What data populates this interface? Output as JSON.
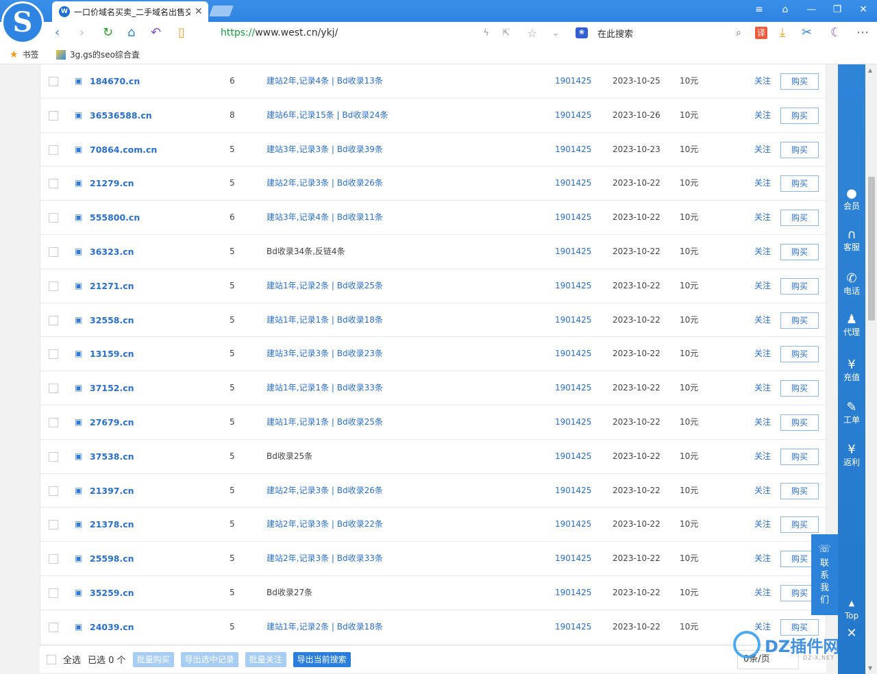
{
  "browser": {
    "tab_title": "一口价域名买卖_二手域名出售交",
    "tab_close": "✕",
    "url_scheme": "https://",
    "url_rest": "www.west.cn/ykj/",
    "search_placeholder": "在此搜索",
    "bookmarks_label": "书签",
    "bookmark_1": "3g.gs的seo综合査"
  },
  "table": {
    "rows": [
      {
        "domain": "184670.cn",
        "len": "6",
        "history": "建站2年,记录4条 | Bd收录13条",
        "seller": "1901425",
        "date": "2023-10-25",
        "price": "10元",
        "follow": "关注",
        "buy": "购买"
      },
      {
        "domain": "36536588.cn",
        "len": "8",
        "history": "建站6年,记录15条 | Bd收录24条",
        "seller": "1901425",
        "date": "2023-10-26",
        "price": "10元",
        "follow": "关注",
        "buy": "购买"
      },
      {
        "domain": "70864.com.cn",
        "len": "5",
        "history": "建站3年,记录3条 | Bd收录39条",
        "seller": "1901425",
        "date": "2023-10-23",
        "price": "10元",
        "follow": "关注",
        "buy": "购买"
      },
      {
        "domain": "21279.cn",
        "len": "5",
        "history": "建站2年,记录3条 | Bd收录26条",
        "seller": "1901425",
        "date": "2023-10-22",
        "price": "10元",
        "follow": "关注",
        "buy": "购买"
      },
      {
        "domain": "555800.cn",
        "len": "6",
        "history": "建站3年,记录4条 | Bd收录11条",
        "seller": "1901425",
        "date": "2023-10-22",
        "price": "10元",
        "follow": "关注",
        "buy": "购买"
      },
      {
        "domain": "36323.cn",
        "len": "5",
        "history": "Bd收录34条,反链4条",
        "seller": "1901425",
        "date": "2023-10-22",
        "price": "10元",
        "follow": "关注",
        "buy": "购买"
      },
      {
        "domain": "21271.cn",
        "len": "5",
        "history": "建站1年,记录2条 | Bd收录25条",
        "seller": "1901425",
        "date": "2023-10-22",
        "price": "10元",
        "follow": "关注",
        "buy": "购买"
      },
      {
        "domain": "32558.cn",
        "len": "5",
        "history": "建站1年,记录1条 | Bd收录18条",
        "seller": "1901425",
        "date": "2023-10-22",
        "price": "10元",
        "follow": "关注",
        "buy": "购买"
      },
      {
        "domain": "13159.cn",
        "len": "5",
        "history": "建站3年,记录3条 | Bd收录23条",
        "seller": "1901425",
        "date": "2023-10-22",
        "price": "10元",
        "follow": "关注",
        "buy": "购买"
      },
      {
        "domain": "37152.cn",
        "len": "5",
        "history": "建站1年,记录1条 | Bd收录33条",
        "seller": "1901425",
        "date": "2023-10-22",
        "price": "10元",
        "follow": "关注",
        "buy": "购买"
      },
      {
        "domain": "27679.cn",
        "len": "5",
        "history": "建站1年,记录1条 | Bd收录25条",
        "seller": "1901425",
        "date": "2023-10-22",
        "price": "10元",
        "follow": "关注",
        "buy": "购买"
      },
      {
        "domain": "37538.cn",
        "len": "5",
        "history": "Bd收录25条",
        "seller": "1901425",
        "date": "2023-10-22",
        "price": "10元",
        "follow": "关注",
        "buy": "购买"
      },
      {
        "domain": "21397.cn",
        "len": "5",
        "history": "建站2年,记录3条 | Bd收录26条",
        "seller": "1901425",
        "date": "2023-10-22",
        "price": "10元",
        "follow": "关注",
        "buy": "购买"
      },
      {
        "domain": "21378.cn",
        "len": "5",
        "history": "建站2年,记录3条 | Bd收录22条",
        "seller": "1901425",
        "date": "2023-10-22",
        "price": "10元",
        "follow": "关注",
        "buy": "购买"
      },
      {
        "domain": "25598.cn",
        "len": "5",
        "history": "建站2年,记录3条 | Bd收录33条",
        "seller": "1901425",
        "date": "2023-10-22",
        "price": "10元",
        "follow": "关注",
        "buy": "购买"
      },
      {
        "domain": "35259.cn",
        "len": "5",
        "history": "Bd收录27条",
        "seller": "1901425",
        "date": "2023-10-22",
        "price": "10元",
        "follow": "关注",
        "buy": "购买"
      },
      {
        "domain": "24039.cn",
        "len": "5",
        "history": "建站1年,记录2条 | Bd收录18条",
        "seller": "1901425",
        "date": "2023-10-22",
        "price": "10元",
        "follow": "关注",
        "buy": "购买"
      }
    ]
  },
  "bottom": {
    "select_all": "全选",
    "selected": "已选 0 个",
    "batch_buy": "批量购买",
    "export_selected": "导出选中记录",
    "batch_follow": "批量关注",
    "export_search": "导出当前搜索",
    "per_page": "0条/页"
  },
  "sidebar": {
    "member": "会员",
    "service": "客服",
    "phone": "电话",
    "agent": "代理",
    "recharge": "充值",
    "ticket": "工单",
    "rebate": "返利",
    "top": "Top",
    "contact": "联系我们"
  },
  "watermark": {
    "text": "DZ插件网",
    "sub": "DZ-X.NET"
  }
}
